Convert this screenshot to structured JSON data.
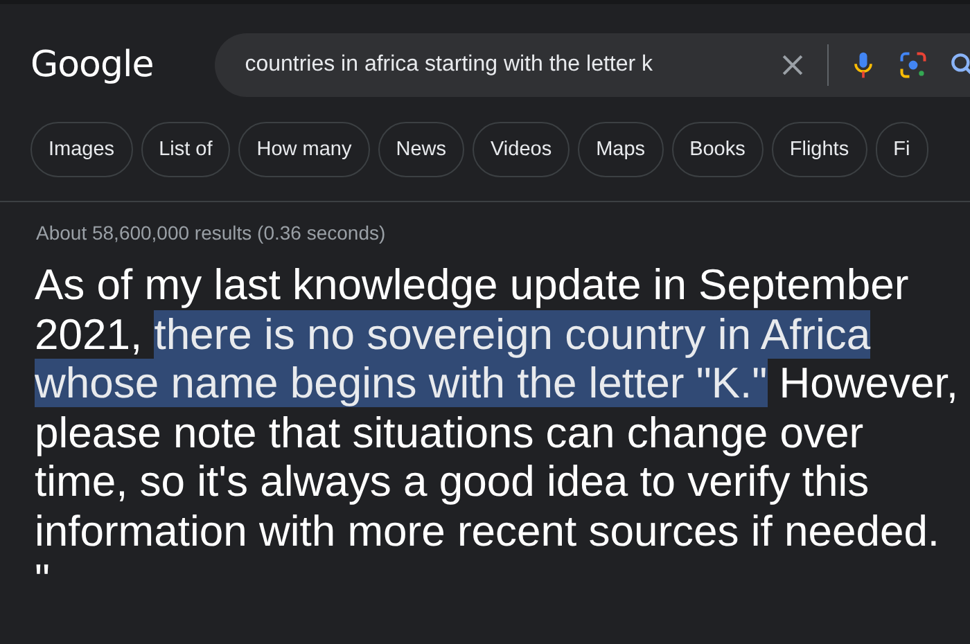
{
  "logo": "Google",
  "search": {
    "value": "countries in africa starting with the letter k"
  },
  "chips": [
    {
      "label": "Images"
    },
    {
      "label": "List of"
    },
    {
      "label": "How many"
    },
    {
      "label": "News"
    },
    {
      "label": "Videos"
    },
    {
      "label": "Maps"
    },
    {
      "label": "Books"
    },
    {
      "label": "Flights"
    },
    {
      "label": "Fi"
    }
  ],
  "result_stats": "About 58,600,000 results (0.36 seconds)",
  "answer": [
    {
      "text": "As of my last knowledge update in September 2021, ",
      "highlighted": false
    },
    {
      "text": "there is no sovereign country in Africa whose name begins with the letter \"K.\"",
      "highlighted": true
    },
    {
      "text": " However, please note that situations can change over time, so it's always a good idea to verify this information with more recent sources if needed. \"",
      "highlighted": false
    }
  ]
}
